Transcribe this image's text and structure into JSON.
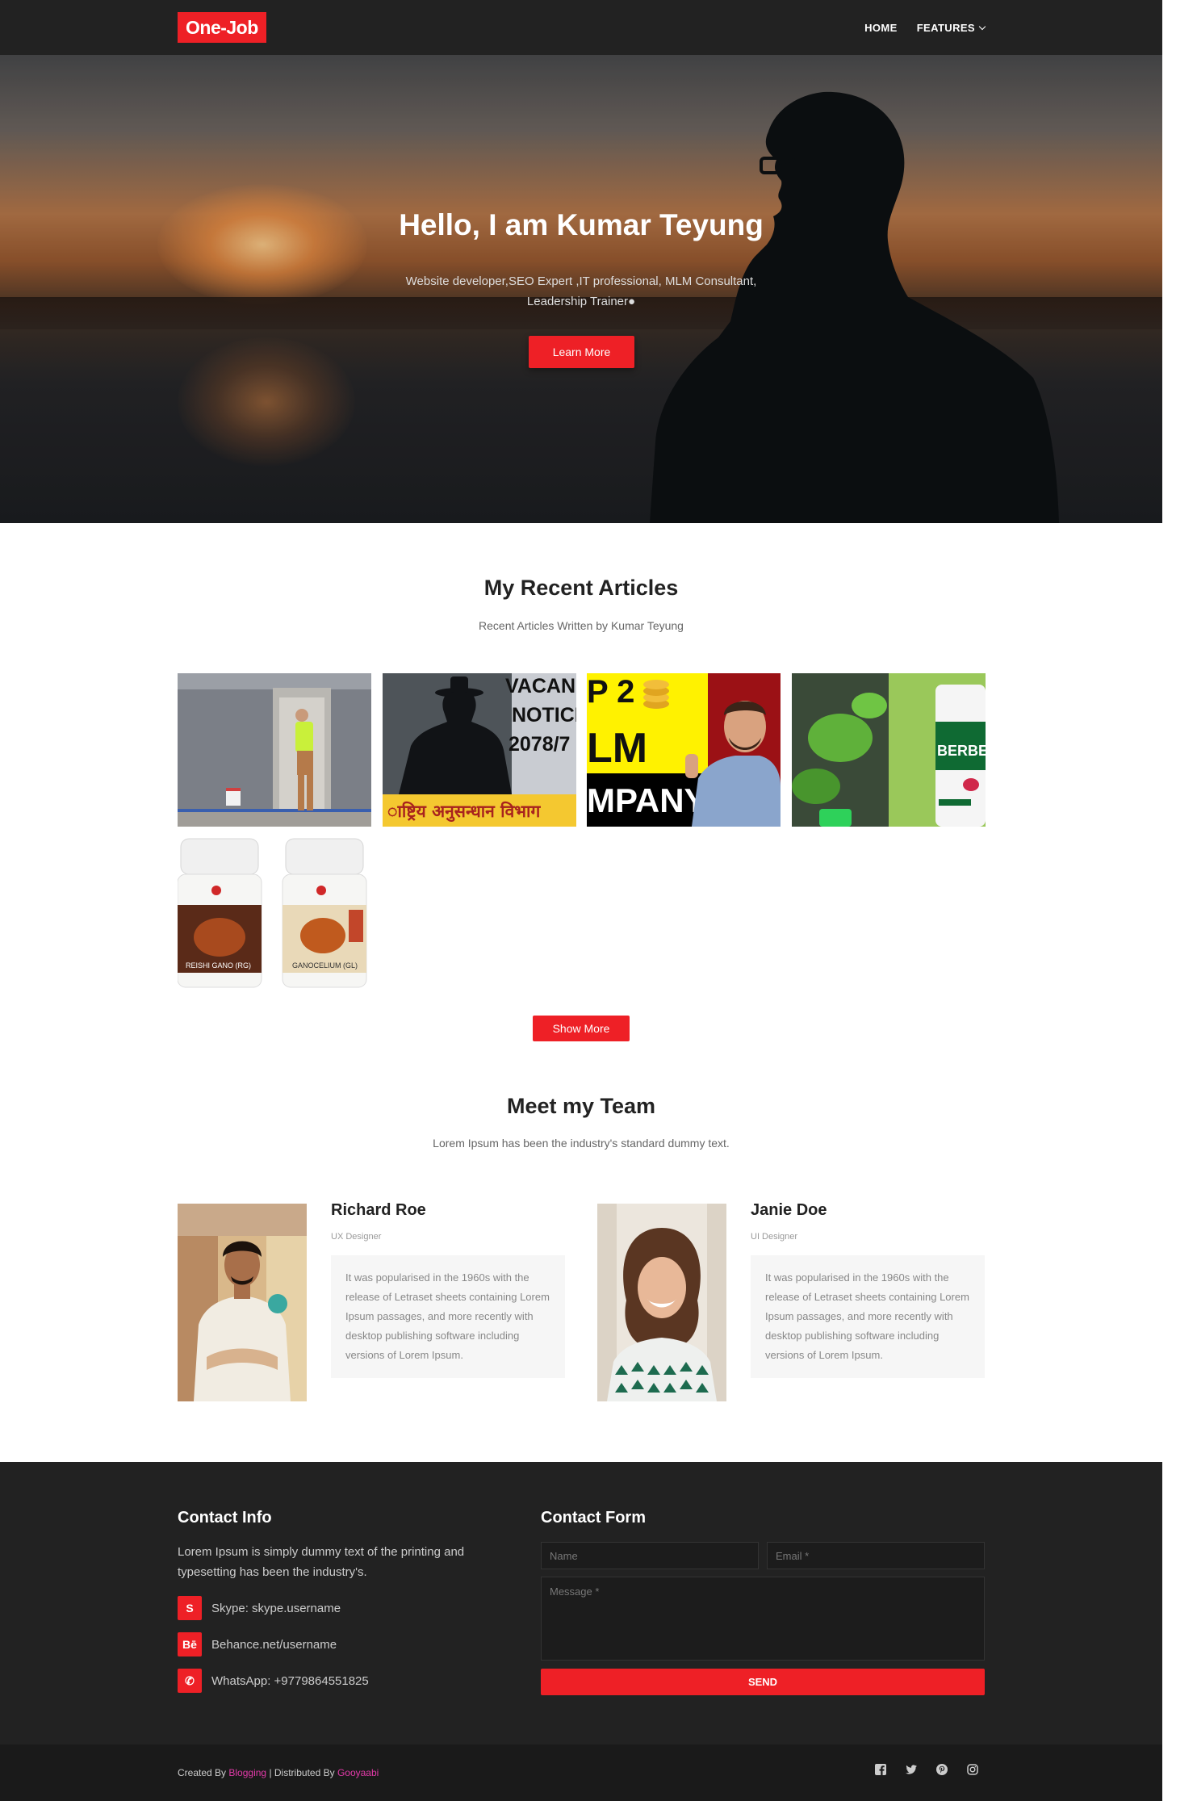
{
  "brand": {
    "name": "One-Job",
    "accent": "#ee2026"
  },
  "nav": {
    "home": "HOME",
    "features": "FEATURES"
  },
  "hero": {
    "title": "Hello, I am Kumar Teyung",
    "subtitle": "Website developer,SEO Expert ,IT professional, MLM Consultant, Leadership Trainer●",
    "button": "Learn More"
  },
  "articles": {
    "title": "My Recent Articles",
    "subtitle": "Recent Articles Written by Kumar Teyung",
    "cards": [
      {
        "image": "worker-painting-wall"
      },
      {
        "image": "vacancy-notice",
        "text_lines": [
          "VACANC",
          "NOTICE",
          "2078/7"
        ],
        "banner": "ाष्ट्रिय अनुसन्धान विभाग"
      },
      {
        "image": "top-mlm-company",
        "text_lines": [
          "P 2",
          "LM",
          "MPANY"
        ]
      },
      {
        "image": "berberine-supplement",
        "text_lines": [
          "BERBERI"
        ]
      },
      {
        "image": "reishi-ganoderma-bottles",
        "text_lines": [
          "REISHI GANO (RG)",
          "GANOCELIUM (GL)"
        ]
      }
    ],
    "show_more": "Show More"
  },
  "team": {
    "title": "Meet my Team",
    "subtitle": "Lorem Ipsum has been the industry's standard dummy text.",
    "members": [
      {
        "name": "Richard Roe",
        "role": "UX Designer",
        "bio": "It was popularised in the 1960s with the release of Letraset sheets containing Lorem Ipsum passages, and more recently with desktop publishing software including versions of Lorem Ipsum."
      },
      {
        "name": "Janie Doe",
        "role": "UI Designer",
        "bio": "It was popularised in the 1960s with the release of Letraset sheets containing Lorem Ipsum passages, and more recently with desktop publishing software including versions of Lorem Ipsum."
      }
    ]
  },
  "contact": {
    "info_title": "Contact Info",
    "info_text": "Lorem Ipsum is simply dummy text of the printing and typesetting has been the industry's.",
    "items": [
      {
        "icon": "skype-icon",
        "glyph": "S",
        "text": "Skype: skype.username"
      },
      {
        "icon": "behance-icon",
        "glyph": "Bē",
        "text": "Behance.net/username"
      },
      {
        "icon": "whatsapp-icon",
        "glyph": "✆",
        "text": "WhatsApp: +9779864551825"
      }
    ],
    "form_title": "Contact Form",
    "name_placeholder": "Name",
    "email_placeholder": "Email *",
    "message_placeholder": "Message *",
    "send": "SEND"
  },
  "footer": {
    "created_by": "Created By",
    "created_link": "Blogging",
    "distributed_by": "| Distributed By",
    "distributed_link": "Gooyaabi",
    "social_icons": [
      "facebook-icon",
      "twitter-icon",
      "pinterest-icon",
      "instagram-icon"
    ]
  }
}
